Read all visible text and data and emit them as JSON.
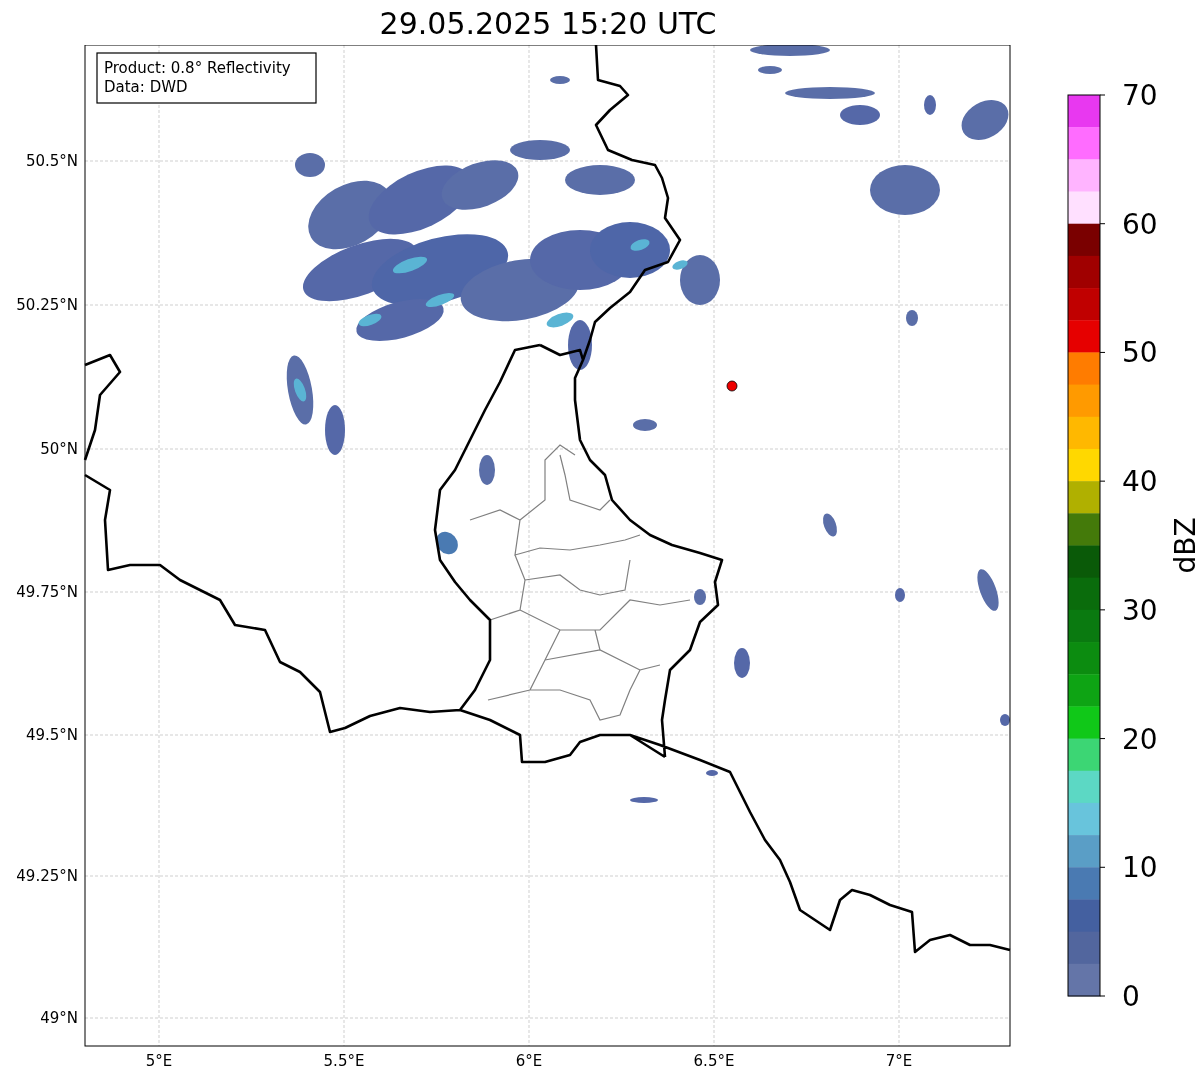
{
  "title": "29.05.2025 15:20 UTC",
  "info_box": {
    "lines": [
      "Product: 0.8° Reflectivity",
      "Data: DWD"
    ]
  },
  "map": {
    "lat_labels": [
      "50.5°N",
      "50.25°N",
      "50°N",
      "49.75°N",
      "49.5°N",
      "49.25°N",
      "49°N"
    ],
    "lon_labels": [
      "5°E",
      "5.5°E",
      "6°E",
      "6.5°E",
      "7°E"
    ]
  },
  "colorbar": {
    "label": "dBZ",
    "ticks": [
      "70",
      "60",
      "50",
      "40",
      "30",
      "20",
      "10",
      "0"
    ],
    "segments": [
      {
        "color": "#e838f0"
      },
      {
        "color": "#ff6cff"
      },
      {
        "color": "#ffb4ff"
      },
      {
        "color": "#ffe0ff"
      },
      {
        "color": "#7a0000"
      },
      {
        "color": "#a00000"
      },
      {
        "color": "#c00000"
      },
      {
        "color": "#e60000"
      },
      {
        "color": "#ff7c00"
      },
      {
        "color": "#ff9a00"
      },
      {
        "color": "#ffb800"
      },
      {
        "color": "#ffd800"
      },
      {
        "color": "#b0b000"
      },
      {
        "color": "#447a0a"
      },
      {
        "color": "#0a5a08"
      },
      {
        "color": "#0a6c0c"
      },
      {
        "color": "#0a7a10"
      },
      {
        "color": "#0c8c10"
      },
      {
        "color": "#0ea414"
      },
      {
        "color": "#10c818"
      },
      {
        "color": "#3cd674"
      },
      {
        "color": "#5cd8c4"
      },
      {
        "color": "#68c4dc"
      },
      {
        "color": "#5a9ec6"
      },
      {
        "color": "#4a7ab2"
      },
      {
        "color": "#4460a0"
      },
      {
        "color": "#52669e"
      },
      {
        "color": "#6475a8"
      }
    ]
  }
}
